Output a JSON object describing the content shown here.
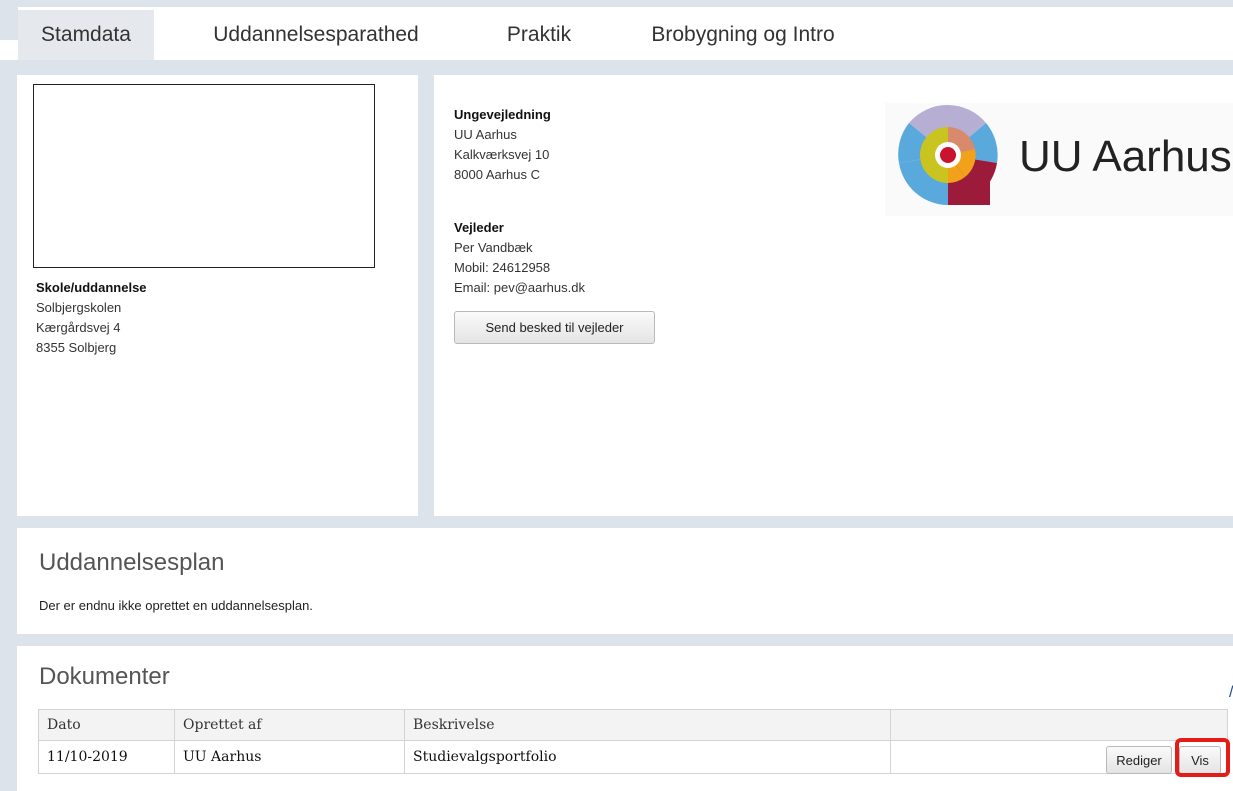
{
  "tabs": [
    {
      "label": "Stamdata",
      "active": true
    },
    {
      "label": "Uddannelsesparathed",
      "active": false
    },
    {
      "label": "Praktik",
      "active": false
    },
    {
      "label": "Brobygning og Intro",
      "active": false
    }
  ],
  "school": {
    "heading": "Skole/uddannelse",
    "name": "Solbjergskolen",
    "street": "Kærgårdsvej 4",
    "city": "8355 Solbjerg"
  },
  "guidance": {
    "heading": "Ungevejledning",
    "org": "UU Aarhus",
    "street": "Kalkværksvej 10",
    "city": "8000 Aarhus C"
  },
  "advisor": {
    "heading": "Vejleder",
    "name": "Per Vandbæk",
    "mobile": "Mobil: 24612958",
    "email": "Email: pev@aarhus.dk",
    "send_button": "Send besked til vejleder"
  },
  "logo": {
    "text": "UU Aarhus",
    "colors": {
      "lavender": "#b7aed4",
      "blue": "#5aa9dc",
      "salmon": "#d98a6c",
      "olive": "#c9c41f",
      "orange": "#f2a11b",
      "crimson": "#9c1b3a",
      "red": "#c8142f"
    }
  },
  "plan": {
    "title": "Uddannelsesplan",
    "note": "Der er endnu ikke oprettet en uddannelsesplan."
  },
  "documents": {
    "title": "Dokumenter",
    "columns": [
      "Dato",
      "Oprettet af",
      "Beskrivelse",
      ""
    ],
    "rows": [
      {
        "date": "11/10-2019",
        "created_by": "UU Aarhus",
        "description": "Studievalgsportfolio"
      }
    ],
    "edit_button": "Rediger",
    "view_button": "Vis"
  },
  "highlight_color": "#e41b17"
}
